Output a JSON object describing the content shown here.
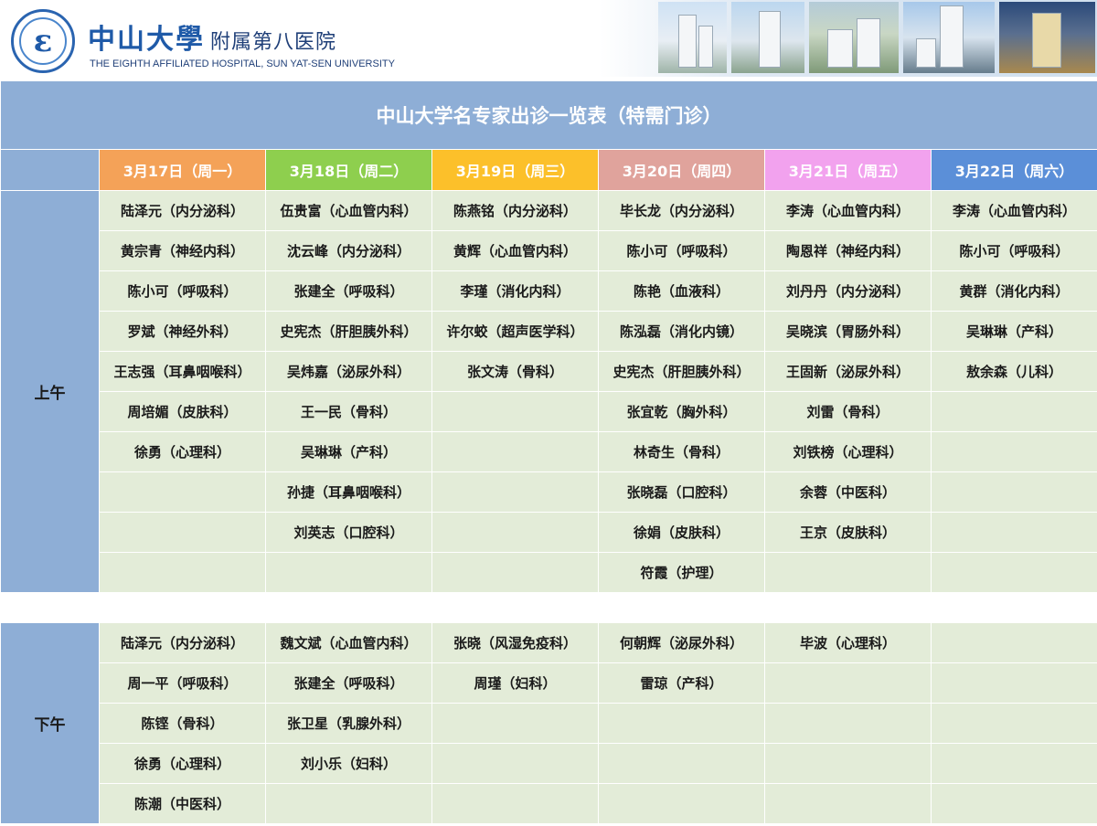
{
  "header": {
    "hospital_name": "中山大學",
    "hospital_sub": "附属第八医院",
    "hospital_en": "THE EIGHTH AFFILIATED HOSPITAL, SUN YAT-SEN UNIVERSITY"
  },
  "table": {
    "title": "中山大学名专家出诊一览表（特需门诊）",
    "days": [
      "3月17日（周一）",
      "3月18日（周二）",
      "3月19日（周三）",
      "3月20日（周四）",
      "3月21日（周五）",
      "3月22日（周六）"
    ],
    "morning_label": "上午",
    "afternoon_label": "下午",
    "morning_rows": [
      [
        "陆泽元（内分泌科）",
        "伍贵富（心血管内科）",
        "陈燕铭（内分泌科）",
        "毕长龙（内分泌科）",
        "李涛（心血管内科）",
        "李涛（心血管内科）"
      ],
      [
        "黄宗青（神经内科）",
        "沈云峰（内分泌科）",
        "黄辉（心血管内科）",
        "陈小可（呼吸科）",
        "陶恩祥（神经内科）",
        "陈小可（呼吸科）"
      ],
      [
        "陈小可（呼吸科）",
        "张建全（呼吸科）",
        "李瑾（消化内科）",
        "陈艳（血液科）",
        "刘丹丹（内分泌科）",
        "黄群（消化内科）"
      ],
      [
        "罗斌（神经外科）",
        "史宪杰（肝胆胰外科）",
        "许尔蛟（超声医学科）",
        "陈泓磊（消化内镜）",
        "吴晓滨（胃肠外科）",
        "吴琳琳（产科）"
      ],
      [
        "王志强（耳鼻咽喉科）",
        "吴炜嘉（泌尿外科）",
        "张文涛（骨科）",
        "史宪杰（肝胆胰外科）",
        "王固新（泌尿外科）",
        "敖余森（儿科）"
      ],
      [
        "周培媚（皮肤科）",
        "王一民（骨科）",
        "",
        "张宜乾（胸外科）",
        "刘雷（骨科）",
        ""
      ],
      [
        "徐勇（心理科）",
        "吴琳琳（产科）",
        "",
        "林奇生（骨科）",
        "刘铁榜（心理科）",
        ""
      ],
      [
        "",
        "孙捷（耳鼻咽喉科）",
        "",
        "张晓磊（口腔科）",
        "余蓉（中医科）",
        ""
      ],
      [
        "",
        "刘英志（口腔科）",
        "",
        "徐娟（皮肤科）",
        "王京（皮肤科）",
        ""
      ],
      [
        "",
        "",
        "",
        "符霞（护理）",
        "",
        ""
      ]
    ],
    "afternoon_rows": [
      [
        "陆泽元（内分泌科）",
        "魏文斌（心血管内科）",
        "张晓（风湿免疫科）",
        "何朝辉（泌尿外科）",
        "毕波（心理科）",
        ""
      ],
      [
        "周一平（呼吸科）",
        "张建全（呼吸科）",
        "周瑾（妇科）",
        "雷琼（产科）",
        "",
        ""
      ],
      [
        "陈铿（骨科）",
        "张卫星（乳腺外科）",
        "",
        "",
        "",
        ""
      ],
      [
        "徐勇（心理科）",
        "刘小乐（妇科）",
        "",
        "",
        "",
        ""
      ],
      [
        "陈潮（中医科）",
        "",
        "",
        "",
        "",
        ""
      ]
    ]
  }
}
